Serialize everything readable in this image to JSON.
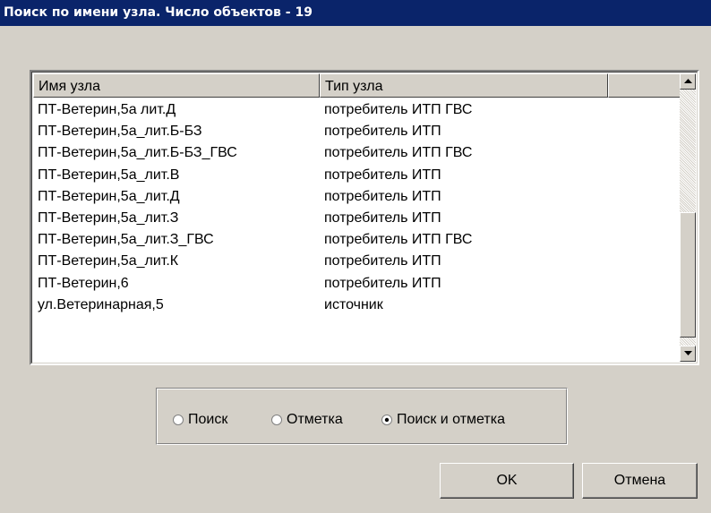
{
  "window": {
    "title": "Поиск по имени узла. Число объектов - 19"
  },
  "list": {
    "columns": [
      "Имя узла",
      "Тип узла",
      ""
    ],
    "rows": [
      {
        "name": "ПТ-Ветерин,5а лит.Д",
        "type": "потребитель ИТП ГВС"
      },
      {
        "name": "ПТ-Ветерин,5а_лит.Б-БЗ",
        "type": "потребитель ИТП"
      },
      {
        "name": "ПТ-Ветерин,5а_лит.Б-БЗ_ГВС",
        "type": "потребитель ИТП ГВС"
      },
      {
        "name": "ПТ-Ветерин,5а_лит.В",
        "type": "потребитель ИТП"
      },
      {
        "name": "ПТ-Ветерин,5а_лит.Д",
        "type": "потребитель ИТП"
      },
      {
        "name": "ПТ-Ветерин,5а_лит.З",
        "type": "потребитель ИТП"
      },
      {
        "name": "ПТ-Ветерин,5а_лит.З_ГВС",
        "type": "потребитель ИТП ГВС"
      },
      {
        "name": "ПТ-Ветерин,5а_лит.К",
        "type": "потребитель ИТП"
      },
      {
        "name": "ПТ-Ветерин,6",
        "type": "потребитель ИТП"
      },
      {
        "name": "ул.Ветеринарная,5",
        "type": "источник"
      }
    ]
  },
  "mode": {
    "options": [
      "Поиск",
      "Отметка",
      "Поиск и отметка"
    ],
    "selected": "Поиск и отметка"
  },
  "buttons": {
    "ok": "OK",
    "cancel": "Отмена"
  },
  "icons": {
    "scroll_up": "scroll-up-arrow-icon",
    "scroll_down": "scroll-down-arrow-icon"
  }
}
